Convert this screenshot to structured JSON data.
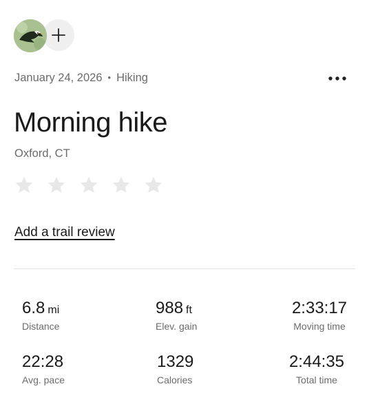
{
  "header": {
    "avatar_icon": "eagle-avatar-icon",
    "add_icon": "plus-icon",
    "date": "January 24, 2026",
    "separator": "•",
    "activity_type": "Hiking",
    "more_icon": "more-horizontal-icon"
  },
  "activity": {
    "title": "Morning hike",
    "location": "Oxford, CT",
    "rating": {
      "value": 0,
      "max": 5
    },
    "review_link": "Add a trail review"
  },
  "stats": [
    {
      "value": "6.8",
      "unit": "mi",
      "label": "Distance"
    },
    {
      "value": "988",
      "unit": "ft",
      "label": "Elev. gain"
    },
    {
      "value": "2:33:17",
      "unit": "",
      "label": "Moving time"
    },
    {
      "value": "22:28",
      "unit": "",
      "label": "Avg. pace"
    },
    {
      "value": "1329",
      "unit": "",
      "label": "Calories"
    },
    {
      "value": "2:44:35",
      "unit": "",
      "label": "Total time"
    }
  ],
  "colors": {
    "text_primary": "#1a1a1a",
    "text_secondary": "#6b6b6b",
    "star_empty": "#e8e8e8",
    "add_button_bg": "#efefef",
    "avatar_bg": "#a9c190"
  }
}
